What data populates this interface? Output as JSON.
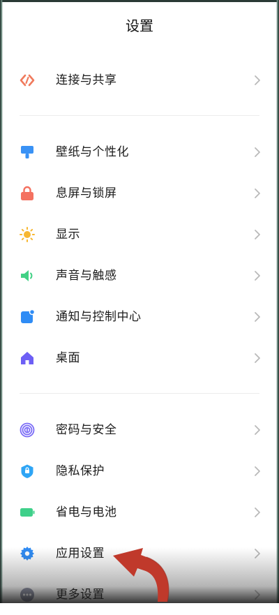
{
  "page": {
    "title": "设置"
  },
  "rows": [
    {
      "key": "connect",
      "label": "连接与共享",
      "icon": "connect-icon",
      "color": "#f07a5c"
    },
    {
      "key": "wallpaper",
      "label": "壁纸与个性化",
      "icon": "paintbrush-icon",
      "color": "#3a92f5"
    },
    {
      "key": "lock",
      "label": "息屏与锁屏",
      "icon": "lock-icon",
      "color": "#f47160"
    },
    {
      "key": "display",
      "label": "显示",
      "icon": "sun-icon",
      "color": "#f7b731"
    },
    {
      "key": "sound",
      "label": "声音与触感",
      "icon": "speaker-icon",
      "color": "#42d185"
    },
    {
      "key": "notify",
      "label": "通知与控制中心",
      "icon": "notification-icon",
      "color": "#2f8cf5"
    },
    {
      "key": "desktop",
      "label": "桌面",
      "icon": "home-icon",
      "color": "#6d5ff5"
    },
    {
      "key": "password",
      "label": "密码与安全",
      "icon": "fingerprint-icon",
      "color": "#7b6cf6"
    },
    {
      "key": "privacy",
      "label": "隐私保护",
      "icon": "shield-icon",
      "color": "#2fa5f5"
    },
    {
      "key": "battery",
      "label": "省电与电池",
      "icon": "battery-icon",
      "color": "#3fd08a"
    },
    {
      "key": "apps",
      "label": "应用设置",
      "icon": "gear-icon",
      "color": "#2f8cf5"
    },
    {
      "key": "more",
      "label": "更多设置",
      "icon": "more-icon",
      "color": "#8b8fa3"
    }
  ],
  "annotation": {
    "icon": "curved-arrow-icon",
    "color": "#c0392b"
  }
}
